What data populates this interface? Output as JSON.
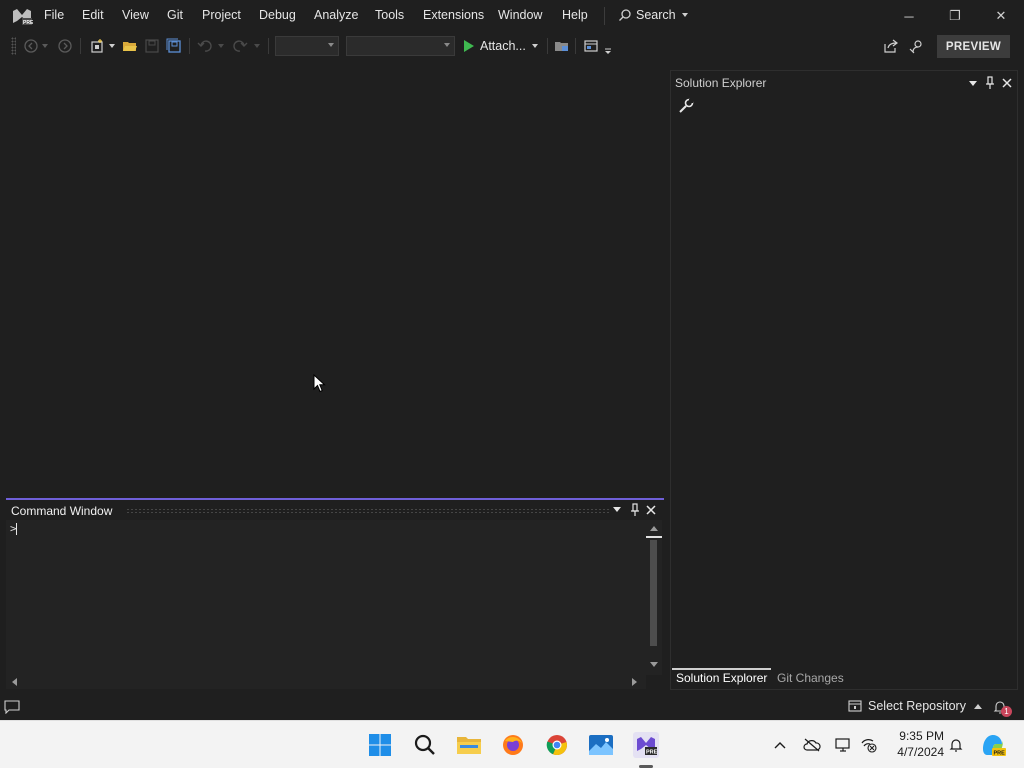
{
  "menu": {
    "items": [
      "File",
      "Edit",
      "View",
      "Git",
      "Project",
      "Debug",
      "Analyze",
      "Tools",
      "Extensions",
      "Window",
      "Help"
    ],
    "search_label": "Search"
  },
  "window_controls": {
    "minimize": "─",
    "restore": "❐",
    "close": "✕"
  },
  "toolbar": {
    "attach_label": "Attach...",
    "preview_label": "PREVIEW"
  },
  "command_window": {
    "title": "Command Window",
    "prompt": ">"
  },
  "solution_explorer": {
    "title": "Solution Explorer",
    "tabs": [
      "Solution Explorer",
      "Git Changes"
    ],
    "active_tab": "Solution Explorer"
  },
  "statusbar": {
    "repository_label": "Select Repository",
    "notification_count": "1"
  },
  "taskbar": {
    "time": "9:35 PM",
    "date": "4/7/2024"
  },
  "colors": {
    "accent": "#6f5fd8",
    "play_green": "#3fb950",
    "background": "#1f1f1f"
  }
}
